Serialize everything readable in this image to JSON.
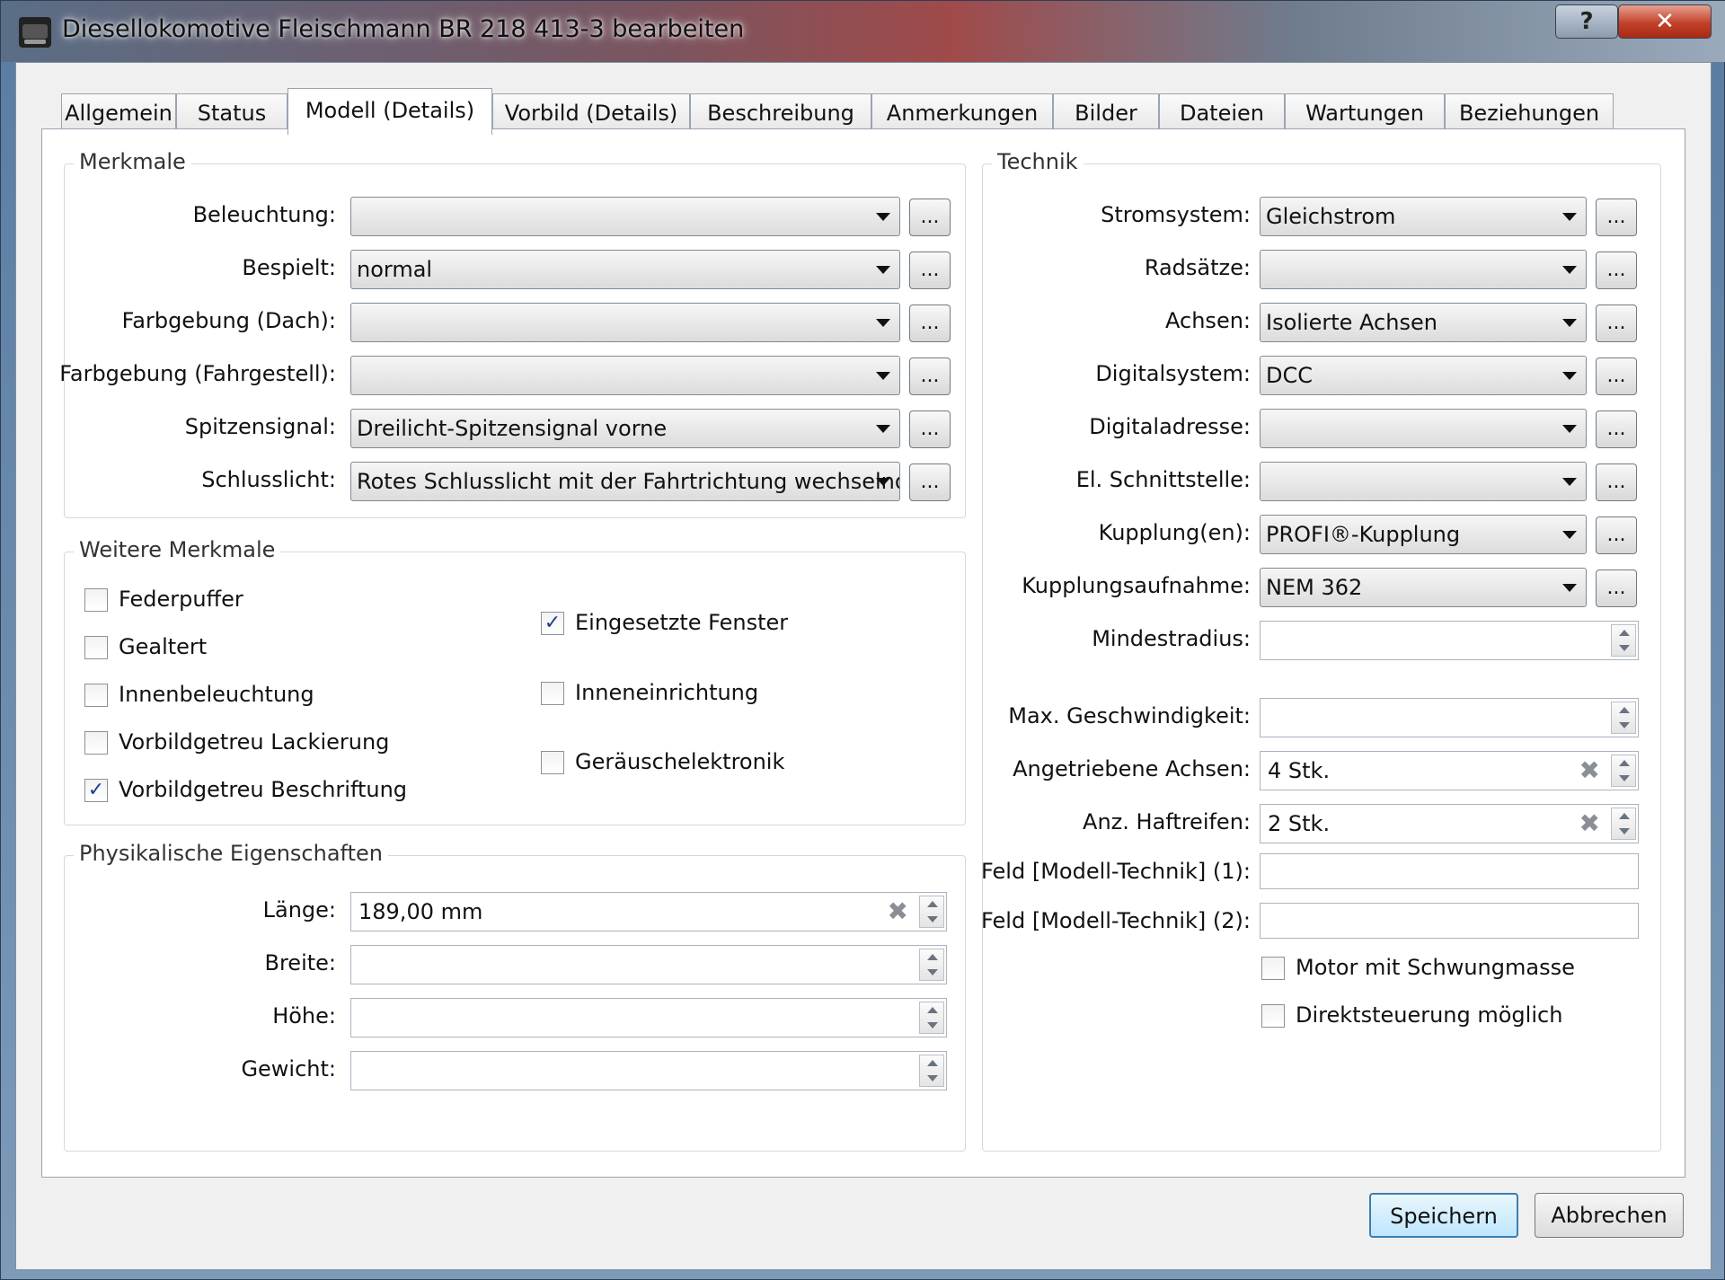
{
  "window": {
    "title": "Diesellokomotive Fleischmann BR 218 413-3 bearbeiten",
    "help_label": "?",
    "close_label": "✕"
  },
  "tabs": [
    {
      "label": "Allgemein"
    },
    {
      "label": "Status"
    },
    {
      "label": "Modell (Details)"
    },
    {
      "label": "Vorbild (Details)"
    },
    {
      "label": "Beschreibung"
    },
    {
      "label": "Anmerkungen"
    },
    {
      "label": "Bilder"
    },
    {
      "label": "Dateien"
    },
    {
      "label": "Wartungen"
    },
    {
      "label": "Beziehungen"
    }
  ],
  "active_tab": "Modell (Details)",
  "merkmale": {
    "title": "Merkmale",
    "rows": [
      {
        "label": "Beleuchtung:",
        "value": ""
      },
      {
        "label": "Bespielt:",
        "value": "normal"
      },
      {
        "label": "Farbgebung (Dach):",
        "value": ""
      },
      {
        "label": "Farbgebung (Fahrgestell):",
        "value": ""
      },
      {
        "label": "Spitzensignal:",
        "value": "Dreilicht-Spitzensignal vorne"
      },
      {
        "label": "Schlusslicht:",
        "value": "Rotes Schlusslicht mit der Fahrtrichtung wechselnd"
      }
    ],
    "more_label": "..."
  },
  "weitere": {
    "title": "Weitere Merkmale",
    "left": [
      {
        "label": "Federpuffer",
        "checked": false
      },
      {
        "label": "Gealtert",
        "checked": false
      },
      {
        "label": "Innenbeleuchtung",
        "checked": false
      },
      {
        "label": "Vorbildgetreu Lackierung",
        "checked": false
      },
      {
        "label": "Vorbildgetreu Beschriftung",
        "checked": true
      }
    ],
    "right": [
      {
        "label": "Eingesetzte Fenster",
        "checked": true
      },
      {
        "label": "Inneneinrichtung",
        "checked": false
      },
      {
        "label": "Geräuschelektronik",
        "checked": false
      }
    ],
    "check_mark": "✓"
  },
  "physik": {
    "title": "Physikalische Eigenschaften",
    "rows": [
      {
        "label": "Länge:",
        "value": "189,00 mm"
      },
      {
        "label": "Breite:",
        "value": ""
      },
      {
        "label": "Höhe:",
        "value": ""
      },
      {
        "label": "Gewicht:",
        "value": ""
      }
    ]
  },
  "technik": {
    "title": "Technik",
    "combos": [
      {
        "label": "Stromsystem:",
        "value": "Gleichstrom"
      },
      {
        "label": "Radsätze:",
        "value": ""
      },
      {
        "label": "Achsen:",
        "value": "Isolierte Achsen"
      },
      {
        "label": "Digitalsystem:",
        "value": "DCC"
      },
      {
        "label": "Digitaladresse:",
        "value": ""
      },
      {
        "label": "El. Schnittstelle:",
        "value": ""
      },
      {
        "label": "Kupplung(en):",
        "value": "PROFI®-Kupplung"
      },
      {
        "label": "Kupplungsaufnahme:",
        "value": "NEM 362"
      }
    ],
    "mindestradius": {
      "label": "Mindestradius:",
      "value": ""
    },
    "max_geschw": {
      "label": "Max. Geschwindigkeit:",
      "value": ""
    },
    "achsen_ang": {
      "label": "Angetriebene Achsen:",
      "value": "4 Stk."
    },
    "haftreifen": {
      "label": "Anz. Haftreifen:",
      "value": "2 Stk."
    },
    "feld1": {
      "label": "Feld [Modell-Technik] (1):",
      "value": ""
    },
    "feld2": {
      "label": "Feld [Modell-Technik] (2):",
      "value": ""
    },
    "motor": {
      "label": "Motor mit Schwungmasse",
      "checked": false
    },
    "direkt": {
      "label": "Direktsteuerung möglich",
      "checked": false
    },
    "clear_label": "✖"
  },
  "buttons": {
    "save": "Speichern",
    "cancel": "Abbrechen"
  }
}
